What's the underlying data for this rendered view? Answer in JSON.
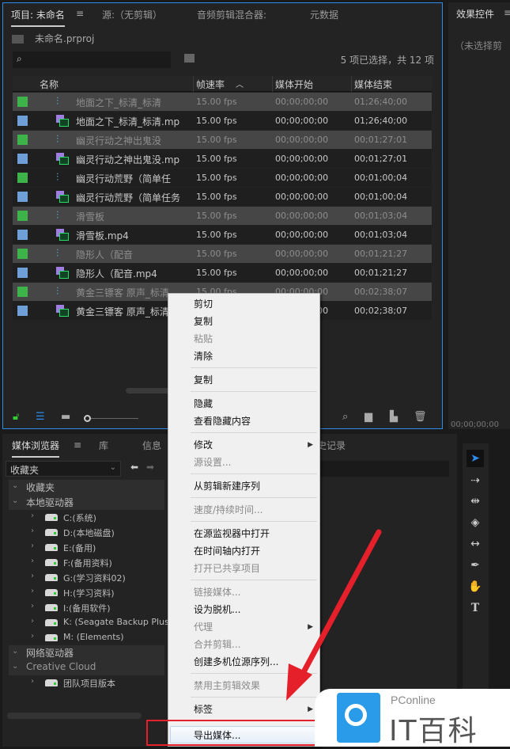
{
  "project_panel": {
    "tabs": [
      "项目: 未命名",
      "源:（无剪辑）",
      "音频剪辑混合器:",
      "元数据"
    ],
    "file": "未命名.prproj",
    "search_placeholder": "",
    "selection_status": "5 项已选择，共 12 项",
    "columns": [
      "名称",
      "帧速率",
      "媒体开始",
      "媒体结束"
    ],
    "rows": [
      {
        "name": "地面之下_标清_标清",
        "fps": "15.00 fps",
        "start": "00;00;00;00",
        "end": "01;26;40;00",
        "type": "sequence",
        "selected": true
      },
      {
        "name": "地面之下_标清_标清.mp",
        "fps": "15.00 fps",
        "start": "00;00;00;00",
        "end": "01;26;40;00",
        "type": "clip",
        "selected": false
      },
      {
        "name": "幽灵行动之神出鬼没",
        "fps": "15.00 fps",
        "start": "00;00;00;00",
        "end": "00;01;27;01",
        "type": "sequence",
        "selected": true
      },
      {
        "name": "幽灵行动之神出鬼没.mp",
        "fps": "15.00 fps",
        "start": "00;00;00;00",
        "end": "00;01;27;01",
        "type": "clip",
        "selected": false
      },
      {
        "name": "幽灵行动荒野（简单任",
        "fps": "15.00 fps",
        "start": "00;00;00;00",
        "end": "00;01;00;04",
        "type": "sequence",
        "selected": false
      },
      {
        "name": "幽灵行动荒野（简单任务",
        "fps": "15.00 fps",
        "start": "00;00;00;00",
        "end": "00;01;00;04",
        "type": "clip",
        "selected": false
      },
      {
        "name": "滑雪板",
        "fps": "15.00 fps",
        "start": "00;00;00;00",
        "end": "00;01;03;04",
        "type": "sequence",
        "selected": true
      },
      {
        "name": "滑雪板.mp4",
        "fps": "15.00 fps",
        "start": "00;00;00;00",
        "end": "00;01;03;04",
        "type": "clip",
        "selected": false
      },
      {
        "name": "隐形人（配音",
        "fps": "15.00 fps",
        "start": "00;00;00;00",
        "end": "00;01;21;27",
        "type": "sequence",
        "selected": true
      },
      {
        "name": "隐形人（配音.mp4",
        "fps": "15.00 fps",
        "start": "00;00;00;00",
        "end": "00;01;21;27",
        "type": "clip",
        "selected": false
      },
      {
        "name": "黄金三镖客 原声_标清",
        "fps": "15.00 fps",
        "start": "00;00;00;00",
        "end": "00;02;38;07",
        "type": "sequence",
        "selected": true
      },
      {
        "name": "黄金三镖客 原声_标清",
        "fps": "15.00 fps",
        "start": "00;00;00;00",
        "end": "00;02;38;07",
        "type": "clip",
        "selected": false
      }
    ]
  },
  "effects_panel": {
    "tab": "效果控件",
    "empty": "（未选择剪",
    "timecode": "00;00;00;00"
  },
  "media_browser": {
    "tabs": [
      "媒体浏览器",
      "库",
      "信息",
      "史记录"
    ],
    "dropdown": "收藏夹",
    "tree": [
      {
        "label": "收藏夹",
        "level": 0
      },
      {
        "label": "本地驱动器",
        "level": 0
      },
      {
        "label": "C:(系统)",
        "level": 1
      },
      {
        "label": "D:(本地磁盘)",
        "level": 1
      },
      {
        "label": "E:(备用)",
        "level": 1
      },
      {
        "label": "F:(备用资料)",
        "level": 1
      },
      {
        "label": "G:(学习资料02)",
        "level": 1
      },
      {
        "label": "H:(学习资料)",
        "level": 1
      },
      {
        "label": "I:(备用软件)",
        "level": 1
      },
      {
        "label": "K: (Seagate Backup Plus D",
        "level": 1
      },
      {
        "label": "M: (Elements)",
        "level": 1
      },
      {
        "label": "网络驱动器",
        "level": 0
      },
      {
        "label": "Creative Cloud",
        "level": 0
      },
      {
        "label": "团队项目版本",
        "level": 1
      }
    ]
  },
  "context_menu": [
    {
      "label": "剪切"
    },
    {
      "label": "复制"
    },
    {
      "label": "粘贴",
      "disabled": true
    },
    {
      "label": "清除"
    },
    {
      "sep": true
    },
    {
      "label": "复制"
    },
    {
      "sep": true
    },
    {
      "label": "隐藏"
    },
    {
      "label": "查看隐藏内容"
    },
    {
      "sep": true
    },
    {
      "label": "修改",
      "submenu": true
    },
    {
      "label": "源设置...",
      "disabled": true
    },
    {
      "sep": true
    },
    {
      "label": "从剪辑新建序列"
    },
    {
      "sep": true
    },
    {
      "label": "速度/持续时间...",
      "disabled": true
    },
    {
      "sep": true
    },
    {
      "label": "在源监视器中打开"
    },
    {
      "label": "在时间轴内打开"
    },
    {
      "label": "打开已共享项目",
      "disabled": true
    },
    {
      "sep": true
    },
    {
      "label": "链接媒体...",
      "disabled": true
    },
    {
      "label": "设为脱机..."
    },
    {
      "label": "代理",
      "submenu": true,
      "disabled": true
    },
    {
      "label": "合并剪辑...",
      "disabled": true
    },
    {
      "label": "创建多机位源序列..."
    },
    {
      "sep": true
    },
    {
      "label": "禁用主剪辑效果",
      "disabled": true
    },
    {
      "sep": true
    },
    {
      "label": "标签",
      "submenu": true
    },
    {
      "sep": true
    },
    {
      "label": "导出媒体...",
      "highlighted": true
    }
  ],
  "watermark": {
    "brand": "PConline",
    "name": "IT百科"
  },
  "colors": {
    "accent": "#2d8ceb",
    "sequence_label": "#3cb44a",
    "clip_label": "#6f9fd8",
    "annotation": "#e5202a"
  }
}
